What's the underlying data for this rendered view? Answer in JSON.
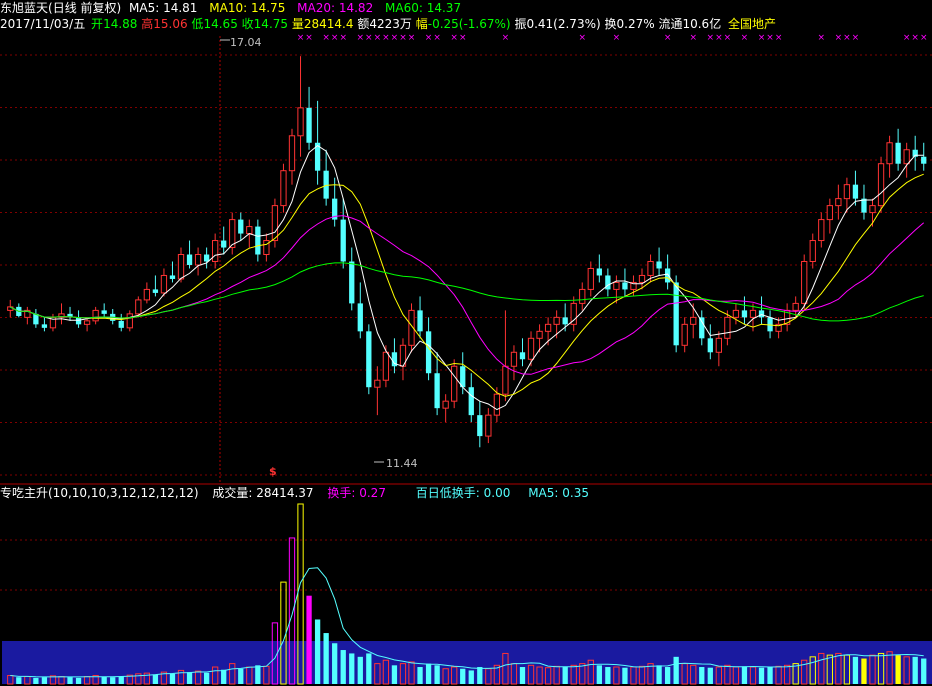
{
  "header": {
    "stock_name": "东旭蓝天",
    "period_label": "(日线 前复权)",
    "ma_labels": [
      {
        "label": "MA5: 14.81",
        "color": "#ffffff"
      },
      {
        "label": "MA10: 14.75",
        "color": "#ffff00"
      },
      {
        "label": "MA20: 14.82",
        "color": "#ff00ff"
      },
      {
        "label": "MA60: 14.37",
        "color": "#00ff00"
      }
    ],
    "date": "2017/11/03/五",
    "open_label": "开",
    "open_value": "14.88",
    "high_label": "高",
    "high_value": "15.06",
    "low_label": "低",
    "low_value": "14.65",
    "close_label": "收",
    "close_value": "14.75",
    "vol_label": "量",
    "vol_value": "28414.4",
    "amt_label": "额",
    "amt_value": "4223万",
    "chg_label": "幅",
    "chg_value": "-0.25(-1.67%)",
    "amp_label": "振",
    "amp_value": "0.41(2.73%)",
    "turn_label": "换",
    "turn_value": "0.27%",
    "float_label": "流通",
    "float_value": "10.6亿",
    "sector": "全国地产"
  },
  "annotations": {
    "high_mark": "17.04",
    "low_mark": "11.44",
    "signal_mark": "$"
  },
  "sub_header": {
    "indicator": "专吃主升(10,10,10,3,12,12,12,12)",
    "volume_text": "成交量: 28414.37",
    "turnover_text": "换手: 0.27",
    "low_turnover_text": "百日低换手: 0.00",
    "ma5_text": "MA5: 0.35"
  },
  "colors": {
    "up": "#ff3333",
    "down": "#54ffff",
    "ma5": "#ffffff",
    "ma10": "#ffff00",
    "ma20": "#ff00ff",
    "ma60": "#00ff00",
    "grid": "#800000",
    "band": "#1a1aa0"
  },
  "chart_data": [
    {
      "type": "candlestick",
      "title": "东旭蓝天",
      "ylim": [
        11.0,
        17.3
      ],
      "price_high": 17.04,
      "price_low": 11.44,
      "ohlc": [
        [
          13.4,
          13.55,
          13.3,
          13.45
        ],
        [
          13.45,
          13.5,
          13.3,
          13.32
        ],
        [
          13.3,
          13.45,
          13.2,
          13.4
        ],
        [
          13.35,
          13.42,
          13.15,
          13.2
        ],
        [
          13.2,
          13.3,
          13.1,
          13.15
        ],
        [
          13.15,
          13.35,
          13.1,
          13.3
        ],
        [
          13.3,
          13.5,
          13.2,
          13.35
        ],
        [
          13.35,
          13.45,
          13.25,
          13.3
        ],
        [
          13.3,
          13.4,
          13.15,
          13.2
        ],
        [
          13.2,
          13.3,
          13.1,
          13.25
        ],
        [
          13.25,
          13.45,
          13.2,
          13.4
        ],
        [
          13.4,
          13.5,
          13.3,
          13.35
        ],
        [
          13.35,
          13.42,
          13.2,
          13.25
        ],
        [
          13.25,
          13.35,
          13.1,
          13.15
        ],
        [
          13.15,
          13.4,
          13.1,
          13.35
        ],
        [
          13.35,
          13.6,
          13.3,
          13.55
        ],
        [
          13.55,
          13.8,
          13.5,
          13.7
        ],
        [
          13.7,
          13.9,
          13.6,
          13.65
        ],
        [
          13.65,
          14.0,
          13.6,
          13.9
        ],
        [
          13.9,
          14.1,
          13.8,
          13.85
        ],
        [
          13.85,
          14.3,
          13.8,
          14.2
        ],
        [
          14.2,
          14.4,
          14.0,
          14.05
        ],
        [
          14.05,
          14.3,
          13.9,
          14.2
        ],
        [
          14.2,
          14.3,
          14.0,
          14.1
        ],
        [
          14.1,
          14.5,
          14.0,
          14.4
        ],
        [
          14.4,
          14.6,
          14.2,
          14.3
        ],
        [
          14.3,
          14.8,
          14.2,
          14.7
        ],
        [
          14.7,
          14.8,
          14.4,
          14.5
        ],
        [
          14.5,
          14.7,
          14.3,
          14.6
        ],
        [
          14.6,
          14.7,
          14.1,
          14.2
        ],
        [
          14.2,
          14.5,
          14.1,
          14.4
        ],
        [
          14.4,
          15.0,
          14.3,
          14.9
        ],
        [
          14.9,
          15.5,
          14.8,
          15.4
        ],
        [
          15.4,
          16.0,
          15.2,
          15.9
        ],
        [
          15.9,
          17.04,
          15.6,
          16.3
        ],
        [
          16.3,
          16.6,
          15.7,
          15.8
        ],
        [
          15.8,
          16.4,
          15.2,
          15.4
        ],
        [
          15.4,
          15.7,
          14.9,
          15.0
        ],
        [
          15.0,
          15.3,
          14.6,
          14.7
        ],
        [
          14.7,
          15.0,
          14.0,
          14.1
        ],
        [
          14.1,
          14.3,
          13.4,
          13.5
        ],
        [
          13.5,
          13.8,
          13.0,
          13.1
        ],
        [
          13.1,
          13.2,
          12.2,
          12.3
        ],
        [
          12.3,
          12.6,
          11.9,
          12.4
        ],
        [
          12.4,
          12.9,
          12.3,
          12.8
        ],
        [
          12.8,
          13.0,
          12.5,
          12.6
        ],
        [
          12.6,
          13.0,
          12.4,
          12.9
        ],
        [
          12.9,
          13.5,
          12.8,
          13.4
        ],
        [
          13.4,
          13.6,
          13.0,
          13.1
        ],
        [
          13.1,
          13.3,
          12.4,
          12.5
        ],
        [
          12.5,
          12.8,
          11.9,
          12.0
        ],
        [
          12.0,
          12.2,
          11.8,
          12.1
        ],
        [
          12.1,
          12.7,
          12.0,
          12.6
        ],
        [
          12.6,
          12.8,
          12.2,
          12.3
        ],
        [
          12.3,
          12.5,
          11.8,
          11.9
        ],
        [
          11.9,
          12.1,
          11.44,
          11.6
        ],
        [
          11.6,
          12.0,
          11.5,
          11.9
        ],
        [
          11.9,
          12.3,
          11.8,
          12.2
        ],
        [
          12.2,
          13.4,
          12.1,
          12.6
        ],
        [
          12.6,
          12.9,
          12.4,
          12.8
        ],
        [
          12.8,
          13.0,
          12.6,
          12.7
        ],
        [
          12.7,
          13.1,
          12.6,
          13.0
        ],
        [
          13.0,
          13.2,
          12.8,
          13.1
        ],
        [
          13.1,
          13.3,
          12.9,
          13.2
        ],
        [
          13.2,
          13.4,
          13.0,
          13.3
        ],
        [
          13.3,
          13.5,
          13.1,
          13.2
        ],
        [
          13.2,
          13.6,
          13.1,
          13.5
        ],
        [
          13.5,
          13.8,
          13.4,
          13.7
        ],
        [
          13.7,
          14.1,
          13.6,
          14.0
        ],
        [
          14.0,
          14.2,
          13.8,
          13.9
        ],
        [
          13.9,
          14.0,
          13.6,
          13.7
        ],
        [
          13.7,
          13.9,
          13.5,
          13.8
        ],
        [
          13.8,
          14.0,
          13.6,
          13.7
        ],
        [
          13.7,
          13.9,
          13.6,
          13.8
        ],
        [
          13.8,
          14.0,
          13.7,
          13.9
        ],
        [
          13.9,
          14.2,
          13.8,
          14.1
        ],
        [
          14.1,
          14.3,
          13.9,
          14.0
        ],
        [
          14.0,
          14.2,
          13.7,
          13.8
        ],
        [
          13.8,
          13.9,
          12.8,
          12.9
        ],
        [
          12.9,
          13.3,
          12.8,
          13.2
        ],
        [
          13.2,
          13.5,
          13.0,
          13.3
        ],
        [
          13.3,
          13.4,
          12.9,
          13.0
        ],
        [
          13.0,
          13.2,
          12.7,
          12.8
        ],
        [
          12.8,
          13.1,
          12.6,
          13.0
        ],
        [
          13.0,
          13.4,
          12.9,
          13.3
        ],
        [
          13.3,
          13.5,
          13.2,
          13.4
        ],
        [
          13.4,
          13.6,
          13.2,
          13.3
        ],
        [
          13.3,
          13.5,
          13.1,
          13.4
        ],
        [
          13.4,
          13.6,
          13.2,
          13.3
        ],
        [
          13.3,
          13.4,
          13.0,
          13.1
        ],
        [
          13.1,
          13.3,
          13.0,
          13.2
        ],
        [
          13.2,
          13.5,
          13.1,
          13.4
        ],
        [
          13.4,
          13.6,
          13.3,
          13.5
        ],
        [
          13.5,
          14.2,
          13.4,
          14.1
        ],
        [
          14.1,
          14.5,
          14.0,
          14.4
        ],
        [
          14.4,
          14.8,
          14.3,
          14.7
        ],
        [
          14.7,
          15.0,
          14.5,
          14.9
        ],
        [
          14.9,
          15.2,
          14.7,
          15.0
        ],
        [
          15.0,
          15.3,
          14.8,
          15.2
        ],
        [
          15.2,
          15.4,
          14.9,
          15.0
        ],
        [
          15.0,
          15.2,
          14.7,
          14.8
        ],
        [
          14.8,
          15.0,
          14.6,
          14.9
        ],
        [
          14.9,
          15.6,
          14.8,
          15.5
        ],
        [
          15.5,
          15.9,
          15.3,
          15.8
        ],
        [
          15.8,
          16.0,
          15.4,
          15.5
        ],
        [
          15.5,
          15.8,
          15.3,
          15.7
        ],
        [
          15.7,
          15.9,
          15.4,
          15.6
        ],
        [
          15.6,
          15.8,
          15.4,
          15.5
        ]
      ],
      "ma_windows": [
        5,
        10,
        20,
        60
      ]
    },
    {
      "type": "bar",
      "title": "成交量",
      "values": [
        0.25,
        0.2,
        0.22,
        0.18,
        0.2,
        0.24,
        0.22,
        0.2,
        0.18,
        0.22,
        0.25,
        0.22,
        0.2,
        0.22,
        0.26,
        0.3,
        0.32,
        0.28,
        0.35,
        0.3,
        0.4,
        0.35,
        0.38,
        0.33,
        0.5,
        0.42,
        0.6,
        0.45,
        0.5,
        0.55,
        0.52,
        1.8,
        3.0,
        4.3,
        5.3,
        2.6,
        1.9,
        1.5,
        1.2,
        1.0,
        0.9,
        0.8,
        0.9,
        0.6,
        0.7,
        0.55,
        0.6,
        0.65,
        0.5,
        0.6,
        0.55,
        0.45,
        0.5,
        0.45,
        0.4,
        0.5,
        0.45,
        0.55,
        0.9,
        0.6,
        0.5,
        0.55,
        0.5,
        0.48,
        0.52,
        0.5,
        0.55,
        0.6,
        0.7,
        0.55,
        0.5,
        0.5,
        0.48,
        0.5,
        0.52,
        0.6,
        0.55,
        0.5,
        0.8,
        0.6,
        0.55,
        0.5,
        0.48,
        0.5,
        0.55,
        0.5,
        0.52,
        0.5,
        0.48,
        0.5,
        0.52,
        0.55,
        0.6,
        0.7,
        0.8,
        0.9,
        0.85,
        0.9,
        0.85,
        0.8,
        0.75,
        0.85,
        0.9,
        0.95,
        0.85,
        0.8,
        0.8,
        0.75
      ]
    }
  ]
}
